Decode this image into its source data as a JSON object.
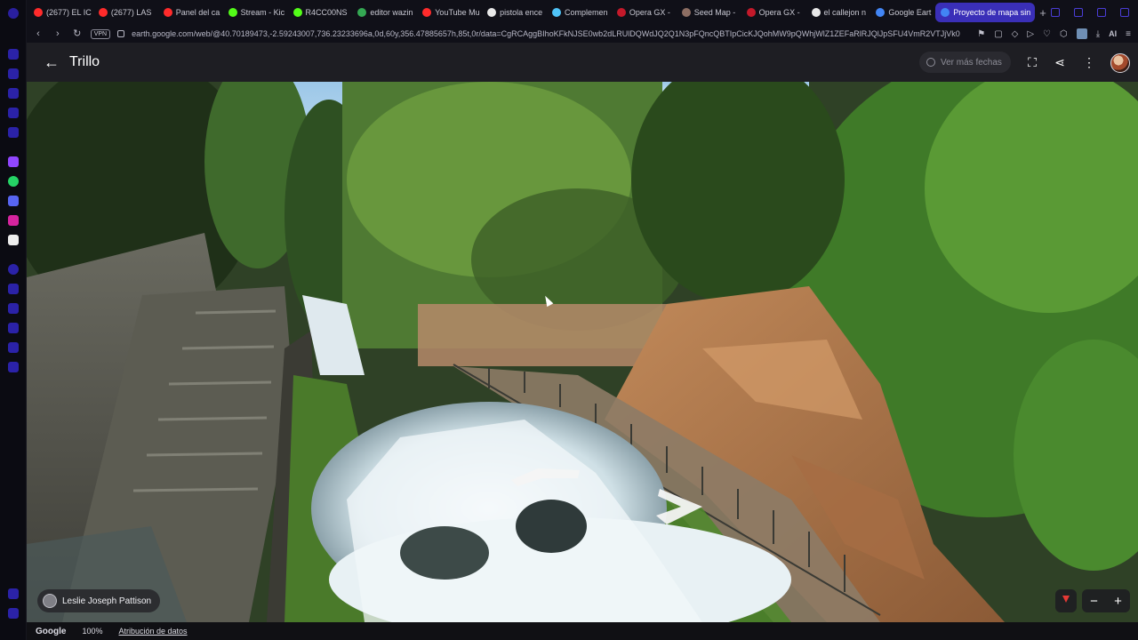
{
  "browser": {
    "tabs": [
      {
        "label": "(2677) EL IC",
        "color": "#ff2b2b"
      },
      {
        "label": "(2677) LAS",
        "color": "#ff2b2b"
      },
      {
        "label": "Panel del ca",
        "color": "#ff2b2b"
      },
      {
        "label": "Stream - Kic",
        "color": "#53fc18"
      },
      {
        "label": "R4CC00NS",
        "color": "#53fc18"
      },
      {
        "label": "editor wazin",
        "color": "#34a853"
      },
      {
        "label": "YouTube Mu",
        "color": "#ff2b2b"
      },
      {
        "label": "pistola ence",
        "color": "#e8e8e8"
      },
      {
        "label": "Complemen",
        "color": "#4fc3f7"
      },
      {
        "label": "Opera GX -",
        "color": "#c4192a"
      },
      {
        "label": "Seed Map -",
        "color": "#8d6e63"
      },
      {
        "label": "Opera GX -",
        "color": "#c4192a"
      },
      {
        "label": "el callejon n",
        "color": "#e8e8e8"
      },
      {
        "label": "Google Eart",
        "color": "#4285f4"
      },
      {
        "label": "Proyecto de mapa sin",
        "color": "#4285f4",
        "active": true
      }
    ],
    "new_tab": "+",
    "vpn_label": "VPN",
    "url": "earth.google.com/web/@40.70189473,-2.59243007,736.23233696a,0d,60y,356.47885657h,85t,0r/data=CgRCAggBIhoKFkNJSE0wb2dLRUlDQWdJQ2Q1N3pFQncQBTIpCicKJQohMW9pQWhjWlZ1ZEFaRlRJQlJpSFU4VmR2VTJjVk0",
    "ai_label": "AI"
  },
  "header": {
    "title": "Trillo",
    "dates_button": "Ver más fechas"
  },
  "viewer": {
    "author": "Leslie Joseph Pattison",
    "zoom_out": "−",
    "zoom_in": "+"
  },
  "footer": {
    "brand": "Google",
    "zoom": "100%",
    "attribution": "Atribución de datos"
  },
  "colors": {
    "accent": "#3a2fb8",
    "header_bg": "#1e1e23"
  }
}
